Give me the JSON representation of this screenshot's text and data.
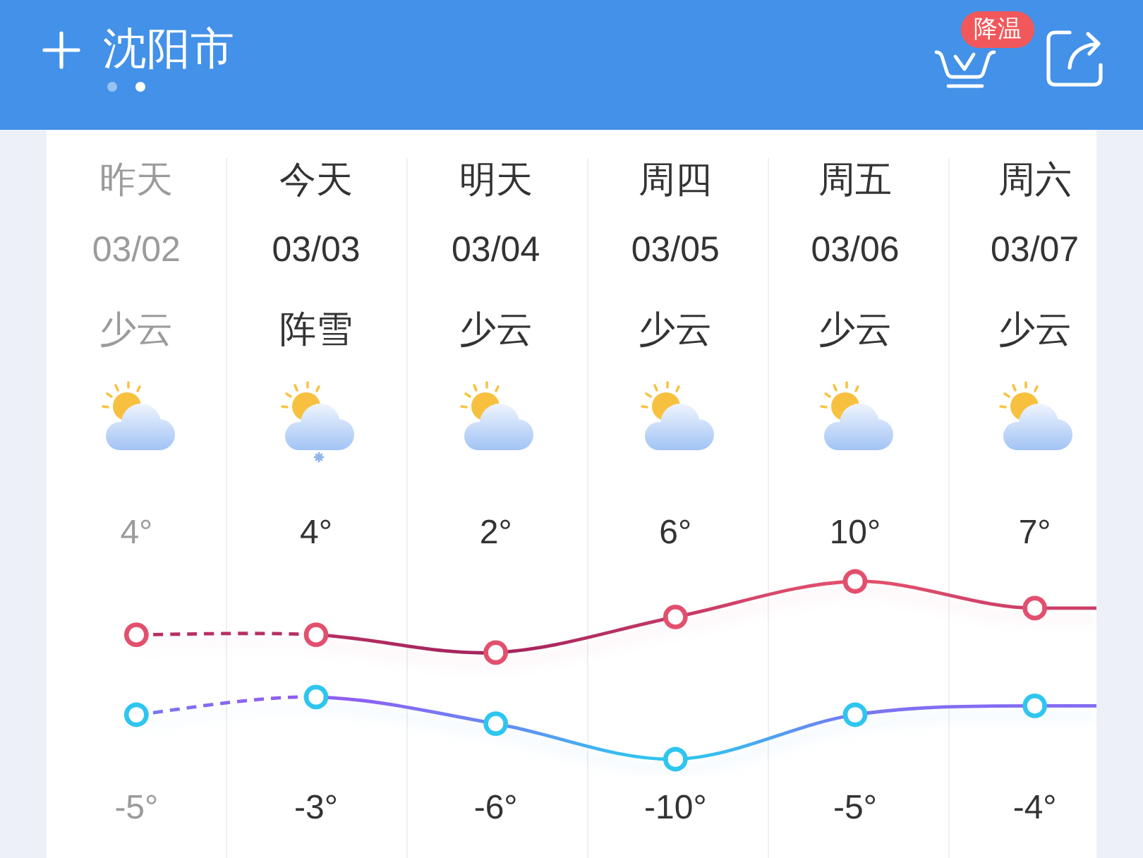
{
  "header": {
    "city": "沈阳市",
    "page_dots": [
      {
        "selected": false
      },
      {
        "selected": true
      }
    ],
    "alert_badge": "降温"
  },
  "days": [
    {
      "label": "昨天",
      "date": "03/02",
      "condition": "少云",
      "kind": "partly_cloudy",
      "high": "4°",
      "low": "-5°",
      "past": true
    },
    {
      "label": "今天",
      "date": "03/03",
      "condition": "阵雪",
      "kind": "snow_shower",
      "high": "4°",
      "low": "-3°",
      "past": false
    },
    {
      "label": "明天",
      "date": "03/04",
      "condition": "少云",
      "kind": "partly_cloudy",
      "high": "2°",
      "low": "-6°",
      "past": false
    },
    {
      "label": "周四",
      "date": "03/05",
      "condition": "少云",
      "kind": "partly_cloudy",
      "high": "6°",
      "low": "-10°",
      "past": false
    },
    {
      "label": "周五",
      "date": "03/06",
      "condition": "少云",
      "kind": "partly_cloudy",
      "high": "10°",
      "low": "-5°",
      "past": false
    },
    {
      "label": "周六",
      "date": "03/07",
      "condition": "少云",
      "kind": "partly_cloudy",
      "high": "7°",
      "low": "-4°",
      "past": false
    }
  ]
}
